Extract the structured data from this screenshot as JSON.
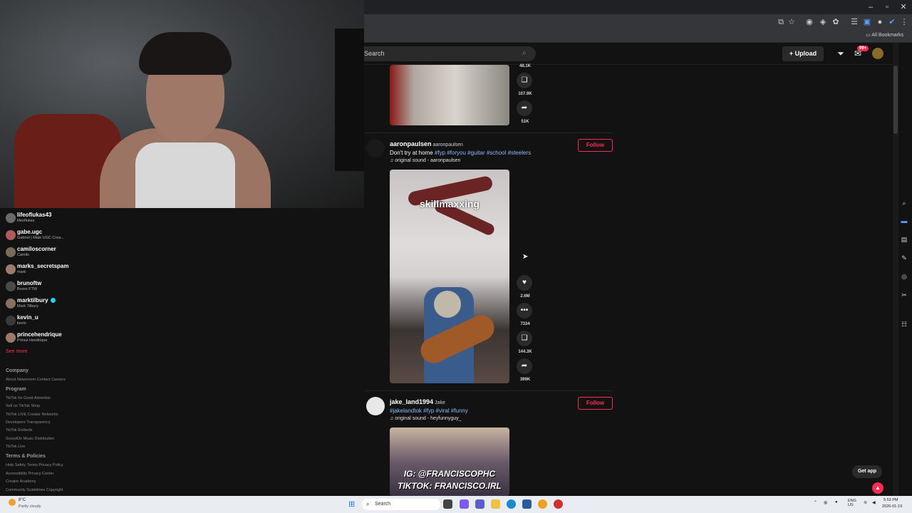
{
  "browser": {
    "bookmarks_label": "All Bookmarks"
  },
  "header": {
    "search_placeholder": "Search",
    "upload_label": "Upload",
    "inbox_badge": "99+"
  },
  "sidebar": {
    "following": [
      {
        "name": "lifeoflukas43",
        "sub": "lifeoflukas",
        "verified": false
      },
      {
        "name": "gabe.ugc",
        "sub": "Gabriel | Male UGC Crea...",
        "verified": false
      },
      {
        "name": "camiloscorner",
        "sub": "Camilo",
        "verified": false
      },
      {
        "name": "marks_secretspam",
        "sub": "mark",
        "verified": false
      },
      {
        "name": "brunoftw",
        "sub": "Bruno FTW",
        "verified": false
      },
      {
        "name": "marktilbury",
        "sub": "Mark Tilbury",
        "verified": true
      },
      {
        "name": "kevin_u",
        "sub": "kevin",
        "verified": false
      },
      {
        "name": "princehendrique",
        "sub": "Prince Hendrique",
        "verified": false
      }
    ],
    "see_more": "See more",
    "footer": {
      "company_heading": "Company",
      "company_links": "About  Newsroom  Contact  Careers",
      "program_heading": "Program",
      "program_links": [
        "TikTok for Good  Advertise",
        "Sell on TikTok Shop",
        "TikTok LIVE Creator Networks",
        "Developers  Transparency",
        "TikTok Embeds",
        "SoundOn Music Distribution",
        "TikTok Live"
      ],
      "terms_heading": "Terms & Policies",
      "terms_links": [
        "Help  Safety  Terms  Privacy Policy",
        "Accessibility  Privacy Center",
        "Creator Academy",
        "Community Guidelines  Copyright"
      ]
    }
  },
  "feed": {
    "prev_post": {
      "comments": "48.1K",
      "saves": "107.9K",
      "shares": "51K"
    },
    "posts": [
      {
        "username": "aaronpaulsen",
        "nickname": "aaronpaulsen",
        "caption_text": "Don't try at home ",
        "hashtags": "#fyp #foryou #guitar #school #steelers",
        "sound": "original sound - aaronpaulsen",
        "follow_label": "Follow",
        "video_overlay": "skillmaxxing",
        "likes": "2.6M",
        "comments": "7334",
        "saves": "144.3K",
        "shares": "399K"
      },
      {
        "username": "jake_land1994",
        "nickname": "Jake",
        "caption_text": "",
        "hashtags": "#jakelandtok #fyp #viral #funny",
        "sound": "original sound - heyfunnyguy_",
        "follow_label": "Follow",
        "video_overlay_1": "IG: @FRANCISCOPHC",
        "video_overlay_2": "TIKTOK: FRANCISCO.IRL"
      }
    ]
  },
  "get_app": "Get app",
  "taskbar": {
    "weather_temp": "8°C",
    "weather_desc": "Partly cloudy",
    "search_label": "Search",
    "lang_1": "ENG",
    "lang_2": "US",
    "time": "5:53 PM",
    "date": "2026-01-19"
  },
  "colors": {
    "accent": "#fe2c55",
    "hashtag": "#8fb8ff",
    "background": "#121212"
  }
}
